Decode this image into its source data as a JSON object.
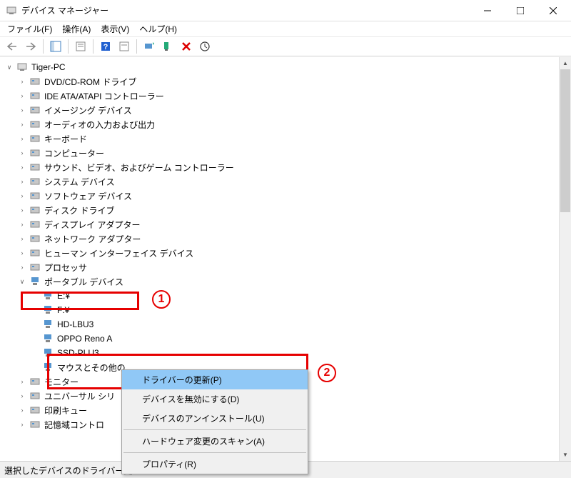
{
  "window": {
    "title": "デバイス マネージャー"
  },
  "menu": {
    "file": "ファイル(F)",
    "action": "操作(A)",
    "view": "表示(V)",
    "help": "ヘルプ(H)"
  },
  "tree": {
    "root": "Tiger-PC",
    "categories": [
      "DVD/CD-ROM ドライブ",
      "IDE ATA/ATAPI コントローラー",
      "イメージング デバイス",
      "オーディオの入力および出力",
      "キーボード",
      "コンピューター",
      "サウンド、ビデオ、およびゲーム コントローラー",
      "システム デバイス",
      "ソフトウェア デバイス",
      "ディスク ドライブ",
      "ディスプレイ アダプター",
      "ネットワーク アダプター",
      "ヒューマン インターフェイス デバイス",
      "プロセッサ"
    ],
    "portable": {
      "label": "ポータブル デバイス",
      "items": [
        "E:¥",
        "F:¥",
        "HD-LBU3",
        "OPPO Reno A",
        "SSD-PLU3",
        "マウスとその他の"
      ]
    },
    "after": [
      "モニター",
      "ユニバーサル シリ",
      "印刷キュー",
      "記憶域コントロ"
    ]
  },
  "context_menu": {
    "update": "ドライバーの更新(P)",
    "disable": "デバイスを無効にする(D)",
    "uninstall": "デバイスのアンインストール(U)",
    "scan": "ハードウェア変更のスキャン(A)",
    "properties": "プロパティ(R)"
  },
  "statusbar": "選択したデバイスのドライバー更",
  "annotations": {
    "n1": "1",
    "n2": "2"
  }
}
